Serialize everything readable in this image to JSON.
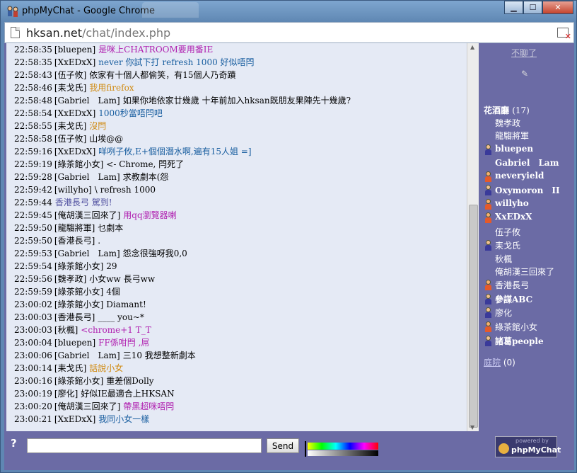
{
  "window": {
    "title": "phpMyChat - Google Chrome",
    "url_host": "hksan.net",
    "url_path": "/chat/index.php"
  },
  "messages": [
    {
      "time": "22:58:35",
      "nick": "[bluepen]",
      "text": "是咪上CHATROOM要用番IE",
      "color": "#b020b0"
    },
    {
      "time": "22:58:35",
      "nick": "[XxEDxX]",
      "text": "never 你試下打 refresh 1000 好似唔閂",
      "color": "#1a5fa0"
    },
    {
      "time": "22:58:43",
      "nick": "[伍子攸]",
      "text": "依家有十個人都偷笑，有15個人乃奇蹟",
      "color": "#000000"
    },
    {
      "time": "22:58:46",
      "nick": "[耒戈氏]",
      "text": "我用firefox",
      "color": "#d08a10"
    },
    {
      "time": "22:58:48",
      "nick": "[Gabriel　Lam]",
      "text": "如果你地依家廿幾歲 十年前加入hksan既朋友果陣先十幾歲?",
      "color": "#000000"
    },
    {
      "time": "22:58:54",
      "nick": "[XxEDxX]",
      "text": "1000秒當唔閂吧",
      "color": "#1a5fa0"
    },
    {
      "time": "22:58:55",
      "nick": "[耒戈氏]",
      "text": "沒閂",
      "color": "#d08a10"
    },
    {
      "time": "22:58:58",
      "nick": "[伍子攸]",
      "text": "山埃@@",
      "color": "#000000"
    },
    {
      "time": "22:59:16",
      "nick": "[XxEDxX]",
      "text": "咩咧子攸,E+個個潛水啊,遍有15人姐 =]",
      "color": "#1a5fa0"
    },
    {
      "time": "22:59:19",
      "nick": "[綠茶館小女]",
      "text": "<- Chrome, 閂死了",
      "color": "#000000"
    },
    {
      "time": "22:59:28",
      "nick": "[Gabriel　Lam]",
      "text": "求教劇本(怨",
      "color": "#000000"
    },
    {
      "time": "22:59:42",
      "nick": "[willyho]",
      "text": "\\ refresh 1000",
      "color": "#000000"
    },
    {
      "time": "22:59:44",
      "nick": "",
      "text": "香港長弓 駕到!",
      "color": "#5050a0"
    },
    {
      "time": "22:59:45",
      "nick": "[俺胡漢三回來了]",
      "text": "用qq瀏覽器喇",
      "color": "#b020b0"
    },
    {
      "time": "22:59:50",
      "nick": "[龍騶將軍]",
      "text": "乜劇本",
      "color": "#000000"
    },
    {
      "time": "22:59:50",
      "nick": "[香港長弓]",
      "text": ".",
      "color": "#000000"
    },
    {
      "time": "22:59:53",
      "nick": "[Gabriel　Lam]",
      "text": "怨念很強呀我0,0",
      "color": "#000000"
    },
    {
      "time": "22:59:54",
      "nick": "[綠茶館小女]",
      "text": "29",
      "color": "#000000"
    },
    {
      "time": "22:59:56",
      "nick": "[魏孝政]",
      "text": "小女ww 長弓ww",
      "color": "#000000"
    },
    {
      "time": "22:59:59",
      "nick": "[綠茶館小女]",
      "text": "4個",
      "color": "#000000"
    },
    {
      "time": "23:00:02",
      "nick": "[綠茶館小女]",
      "text": "Diamant!",
      "color": "#000000"
    },
    {
      "time": "23:00:03",
      "nick": "[香港長弓]",
      "text": "____ you~*",
      "color": "#000000"
    },
    {
      "time": "23:00:03",
      "nick": "[秋楓]",
      "text": "<chrome+1 T_T",
      "color": "#b020b0"
    },
    {
      "time": "23:00:04",
      "nick": "[bluepen]",
      "text": "FF係咁閂 ,屌",
      "color": "#b020b0"
    },
    {
      "time": "23:00:06",
      "nick": "[Gabriel　Lam]",
      "text": "三10 我想整新劇本",
      "color": "#000000"
    },
    {
      "time": "23:00:14",
      "nick": "[耒戈氏]",
      "text": "話說小女",
      "color": "#d08a10"
    },
    {
      "time": "23:00:16",
      "nick": "[綠茶館小女]",
      "text": "重差個Dolly",
      "color": "#000000"
    },
    {
      "time": "23:00:19",
      "nick": "[廖化]",
      "text": "好似IE最適合上HKSAN",
      "color": "#000000"
    },
    {
      "time": "23:00:20",
      "nick": "[俺胡漢三回來了]",
      "text": "帶黑超咪唔閂",
      "color": "#b020b0"
    },
    {
      "time": "23:00:21",
      "nick": "[XxEDxX]",
      "text": "我同小女一樣",
      "color": "#1a5fa0"
    }
  ],
  "sidebar": {
    "bored_link": "不聊了",
    "room_name": "花酒廳",
    "room_count": "(17)",
    "users": [
      {
        "name": "魏孝政",
        "icon": "none",
        "bold": false
      },
      {
        "name": "龍騶將軍",
        "icon": "none",
        "bold": false
      },
      {
        "name": "bluepen",
        "icon": "male",
        "bold": true
      },
      {
        "name": "Gabriel　Lam",
        "icon": "none",
        "bold": true
      },
      {
        "name": "neveryield",
        "icon": "female",
        "bold": true
      },
      {
        "name": "Oxymoron　II",
        "icon": "male",
        "bold": true
      },
      {
        "name": "willyho",
        "icon": "female",
        "bold": true
      },
      {
        "name": "XxEDxX",
        "icon": "female",
        "bold": true
      },
      {
        "name": "伍子攸",
        "icon": "none",
        "bold": false
      },
      {
        "name": "耒戈氏",
        "icon": "male",
        "bold": false
      },
      {
        "name": "秋楓",
        "icon": "none",
        "bold": false
      },
      {
        "name": "俺胡漢三回來了",
        "icon": "none",
        "bold": false
      },
      {
        "name": "香港長弓",
        "icon": "female",
        "bold": false
      },
      {
        "name": "參謀ABC",
        "icon": "male",
        "bold": true
      },
      {
        "name": "廖化",
        "icon": "male",
        "bold": false
      },
      {
        "name": "綠茶館小女",
        "icon": "female",
        "bold": false
      },
      {
        "name": "諸葛people",
        "icon": "male",
        "bold": true
      }
    ],
    "lobby_link": "庭院",
    "lobby_count": "(0)"
  },
  "input": {
    "message_placeholder": "",
    "send_label": "Send"
  },
  "footer": {
    "powered_by": "powered by",
    "brand": "phpMyChat"
  }
}
